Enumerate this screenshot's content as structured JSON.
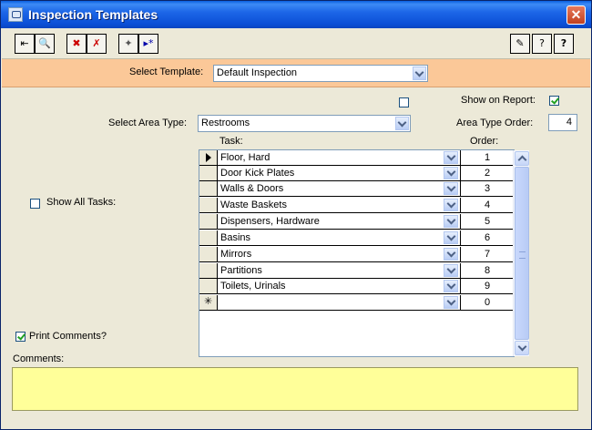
{
  "window": {
    "title": "Inspection Templates",
    "close_glyph": "✕"
  },
  "toolbar": {
    "left_buttons": [
      {
        "name": "exit-icon",
        "glyph": "⇤"
      },
      {
        "name": "preview-icon",
        "glyph": "🔍"
      },
      {
        "name": "delete-record-icon",
        "glyph": "✖"
      },
      {
        "name": "undo-icon",
        "glyph": "✗"
      },
      {
        "name": "wand-icon",
        "glyph": "✦"
      },
      {
        "name": "new-record-icon",
        "glyph": "▸*"
      }
    ],
    "right_buttons": [
      {
        "name": "spelling-icon",
        "glyph": "✎"
      },
      {
        "name": "help-book-icon",
        "glyph": "?"
      },
      {
        "name": "help-question-icon",
        "glyph": "?"
      }
    ]
  },
  "template": {
    "label": "Select Template:",
    "value": "Default Inspection"
  },
  "report": {
    "show_on_report_label": "Show on Report:",
    "show_on_report": true,
    "unlabeled_check": false
  },
  "area": {
    "label": "Select Area Type:",
    "value": "Restrooms",
    "order_label": "Area Type Order:",
    "order_value": "4"
  },
  "grid": {
    "task_header": "Task:",
    "order_header": "Order:",
    "rows": [
      {
        "task": "Floor, Hard",
        "order": "1"
      },
      {
        "task": "Door Kick Plates",
        "order": "2"
      },
      {
        "task": "Walls & Doors",
        "order": "3"
      },
      {
        "task": "Waste Baskets",
        "order": "4"
      },
      {
        "task": "Dispensers, Hardware",
        "order": "5"
      },
      {
        "task": "Basins",
        "order": "6"
      },
      {
        "task": "Mirrors",
        "order": "7"
      },
      {
        "task": "Partitions",
        "order": "8"
      },
      {
        "task": "Toilets, Urinals",
        "order": "9"
      },
      {
        "task": "",
        "order": "0"
      }
    ]
  },
  "show_all_tasks": {
    "label": "Show All Tasks:",
    "checked": false
  },
  "print_comments": {
    "label": "Print Comments?",
    "checked": true
  },
  "comments": {
    "label": "Comments:",
    "value": ""
  },
  "colors": {
    "header_band": "#fbc898",
    "comments_bg": "#ffff99",
    "titlebar": "#0b4fd6"
  }
}
